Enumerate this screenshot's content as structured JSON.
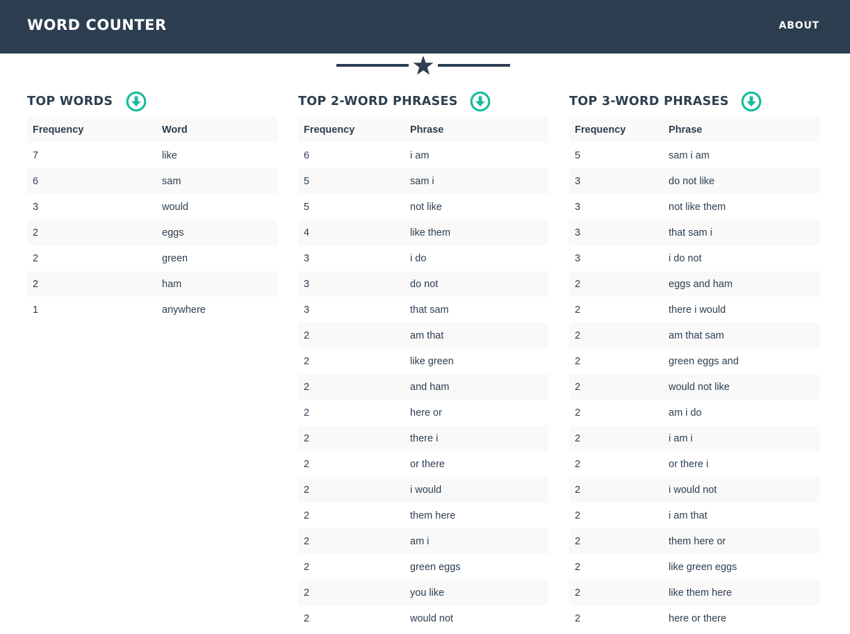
{
  "header": {
    "brand": "WORD COUNTER",
    "about": "ABOUT",
    "bg_color": "#2c3e50"
  },
  "divider": {
    "icon": "star-icon"
  },
  "accent_color": "#18bc9c",
  "top_words": {
    "title": "TOP WORDS",
    "download_icon": "download-circle-icon",
    "headers": [
      "Frequency",
      "Word"
    ],
    "rows": [
      [
        "7",
        "like"
      ],
      [
        "6",
        "sam"
      ],
      [
        "3",
        "would"
      ],
      [
        "2",
        "eggs"
      ],
      [
        "2",
        "green"
      ],
      [
        "2",
        "ham"
      ],
      [
        "1",
        "anywhere"
      ]
    ]
  },
  "top_2": {
    "title": "TOP 2-WORD PHRASES",
    "download_icon": "download-circle-icon",
    "headers": [
      "Frequency",
      "Phrase"
    ],
    "rows": [
      [
        "6",
        "i am"
      ],
      [
        "5",
        "sam i"
      ],
      [
        "5",
        "not like"
      ],
      [
        "4",
        "like them"
      ],
      [
        "3",
        "i do"
      ],
      [
        "3",
        "do not"
      ],
      [
        "3",
        "that sam"
      ],
      [
        "2",
        "am that"
      ],
      [
        "2",
        "like green"
      ],
      [
        "2",
        "and ham"
      ],
      [
        "2",
        "here or"
      ],
      [
        "2",
        "there i"
      ],
      [
        "2",
        "or there"
      ],
      [
        "2",
        "i would"
      ],
      [
        "2",
        "them here"
      ],
      [
        "2",
        "am i"
      ],
      [
        "2",
        "green eggs"
      ],
      [
        "2",
        "you like"
      ],
      [
        "2",
        "would not"
      ]
    ]
  },
  "top_3": {
    "title": "TOP 3-WORD PHRASES",
    "download_icon": "download-circle-icon",
    "headers": [
      "Frequency",
      "Phrase"
    ],
    "rows": [
      [
        "5",
        "sam i am"
      ],
      [
        "3",
        "do not like"
      ],
      [
        "3",
        "not like them"
      ],
      [
        "3",
        "that sam i"
      ],
      [
        "3",
        "i do not"
      ],
      [
        "2",
        "eggs and ham"
      ],
      [
        "2",
        "there i would"
      ],
      [
        "2",
        "am that sam"
      ],
      [
        "2",
        "green eggs and"
      ],
      [
        "2",
        "would not like"
      ],
      [
        "2",
        "am i do"
      ],
      [
        "2",
        "i am i"
      ],
      [
        "2",
        "or there i"
      ],
      [
        "2",
        "i would not"
      ],
      [
        "2",
        "i am that"
      ],
      [
        "2",
        "them here or"
      ],
      [
        "2",
        "like green eggs"
      ],
      [
        "2",
        "like them here"
      ],
      [
        "2",
        "here or there"
      ]
    ]
  }
}
